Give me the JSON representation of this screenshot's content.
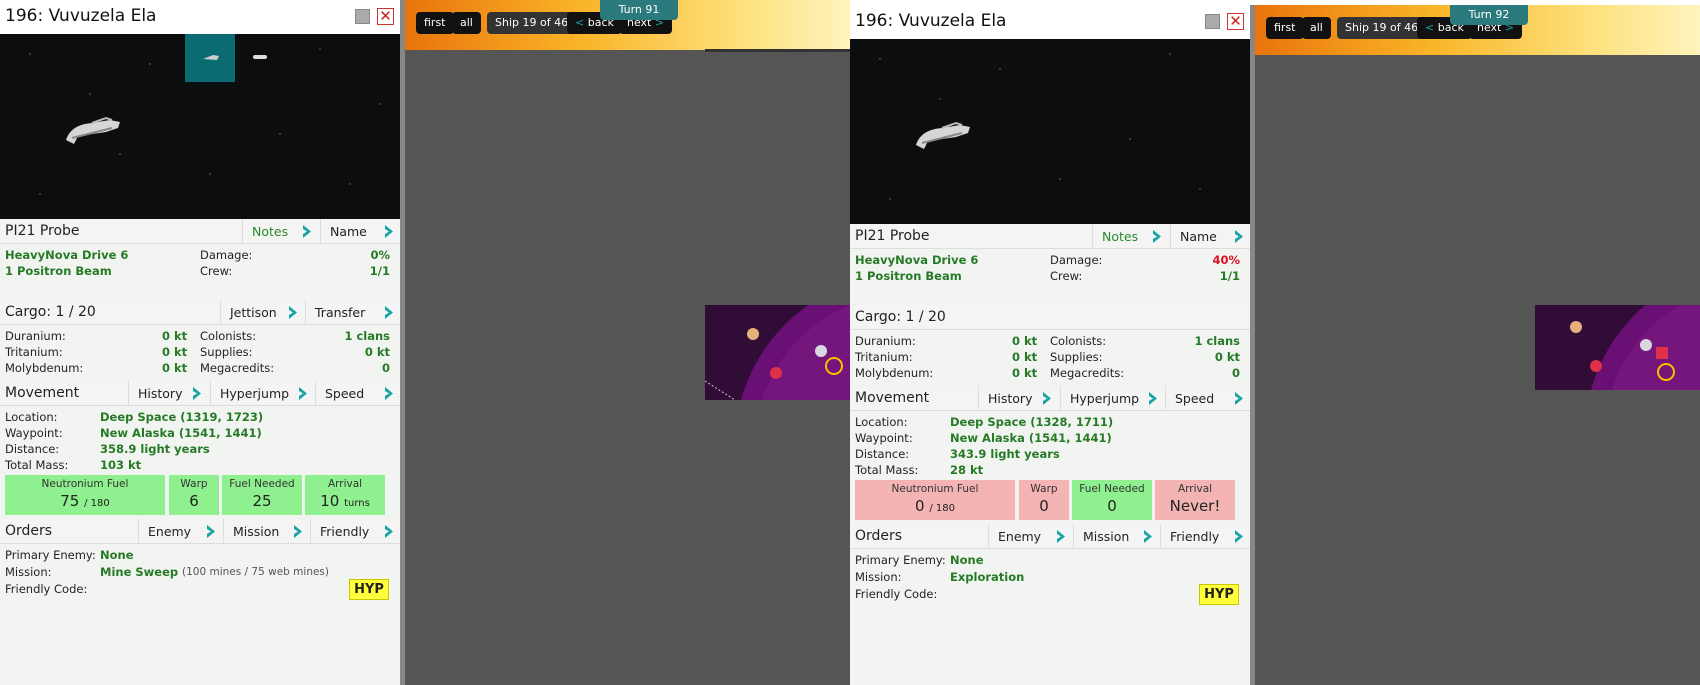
{
  "panels": [
    {
      "title": "196: Vuvuzela Ela",
      "hull": "PI21 Probe",
      "notes_label": "Notes",
      "name_label": "Name",
      "engine": "HeavyNova Drive 6",
      "weapons": "1 Positron Beam",
      "damage_label": "Damage:",
      "damage": "0%",
      "crew_label": "Crew:",
      "crew": "1/1",
      "cargo_title": "Cargo: 1 / 20",
      "jettison_label": "Jettison",
      "transfer_label": "Transfer",
      "cargo": [
        {
          "label": "Duranium:",
          "value": "0 kt",
          "label2": "Colonists:",
          "value2": "1 clans"
        },
        {
          "label": "Tritanium:",
          "value": "0 kt",
          "label2": "Supplies:",
          "value2": "0 kt"
        },
        {
          "label": "Molybdenum:",
          "value": "0 kt",
          "label2": "Megacredits:",
          "value2": "0"
        }
      ],
      "movement_title": "Movement",
      "history_label": "History",
      "hyperjump_label": "Hyperjump",
      "speed_label": "Speed",
      "location_label": "Location:",
      "location": "Deep Space (1319, 1723)",
      "waypoint_label": "Waypoint:",
      "waypoint": "New Alaska (1541, 1441)",
      "distance_label": "Distance:",
      "distance": "358.9 light years",
      "mass_label": "Total Mass:",
      "mass": "103 kt",
      "fuel_label": "Neutronium Fuel",
      "fuel": "75",
      "fuel_max": "/ 180",
      "warp_label": "Warp",
      "warp": "6",
      "needed_label": "Fuel Needed",
      "needed": "25",
      "arrival_label": "Arrival",
      "arrival": "10",
      "arrival_unit": "turns",
      "orders_title": "Orders",
      "enemy_label": "Enemy",
      "mission_btn_label": "Mission",
      "friendly_label": "Friendly",
      "primary_enemy_label": "Primary Enemy:",
      "primary_enemy": "None",
      "mission_label": "Mission:",
      "mission": "Mine Sweep",
      "mission_detail": "(100 mines / 75 web mines)",
      "friendly_code_label": "Friendly Code:",
      "friendly_code": "HYP"
    },
    {
      "title": "196: Vuvuzela Ela",
      "hull": "PI21 Probe",
      "notes_label": "Notes",
      "name_label": "Name",
      "engine": "HeavyNova Drive 6",
      "weapons": "1 Positron Beam",
      "damage_label": "Damage:",
      "damage": "40%",
      "crew_label": "Crew:",
      "crew": "1/1",
      "cargo_title": "Cargo: 1 / 20",
      "cargo": [
        {
          "label": "Duranium:",
          "value": "0 kt",
          "label2": "Colonists:",
          "value2": "1 clans"
        },
        {
          "label": "Tritanium:",
          "value": "0 kt",
          "label2": "Supplies:",
          "value2": "0 kt"
        },
        {
          "label": "Molybdenum:",
          "value": "0 kt",
          "label2": "Megacredits:",
          "value2": "0"
        }
      ],
      "movement_title": "Movement",
      "history_label": "History",
      "hyperjump_label": "Hyperjump",
      "speed_label": "Speed",
      "location_label": "Location:",
      "location": "Deep Space (1328, 1711)",
      "waypoint_label": "Waypoint:",
      "waypoint": "New Alaska (1541, 1441)",
      "distance_label": "Distance:",
      "distance": "343.9 light years",
      "mass_label": "Total Mass:",
      "mass": "28 kt",
      "fuel_label": "Neutronium Fuel",
      "fuel": "0",
      "fuel_max": "/ 180",
      "warp_label": "Warp",
      "warp": "0",
      "needed_label": "Fuel Needed",
      "needed": "0",
      "arrival_label": "Arrival",
      "arrival": "Never!",
      "orders_title": "Orders",
      "enemy_label": "Enemy",
      "mission_btn_label": "Mission",
      "friendly_label": "Friendly",
      "primary_enemy_label": "Primary Enemy:",
      "primary_enemy": "None",
      "mission_label": "Mission:",
      "mission": "Exploration",
      "friendly_code_label": "Friendly Code:",
      "friendly_code": "HYP"
    }
  ],
  "navs": [
    {
      "first": "first",
      "all": "all",
      "ship_counter": "Ship 19 of 46",
      "back": "back",
      "next": "next",
      "turn": "Turn 91"
    },
    {
      "first": "first",
      "all": "all",
      "ship_counter": "Ship 19 of 46",
      "back": "back",
      "next": "next",
      "turn": "Turn 92"
    }
  ],
  "colors": {
    "accent_teal": "#1aa3a3",
    "green_value": "#257a25",
    "good_box": "#8ef08e",
    "bad_box": "#f4b4b4",
    "damage_red": "#dd1122",
    "map_bg": "#555555"
  }
}
